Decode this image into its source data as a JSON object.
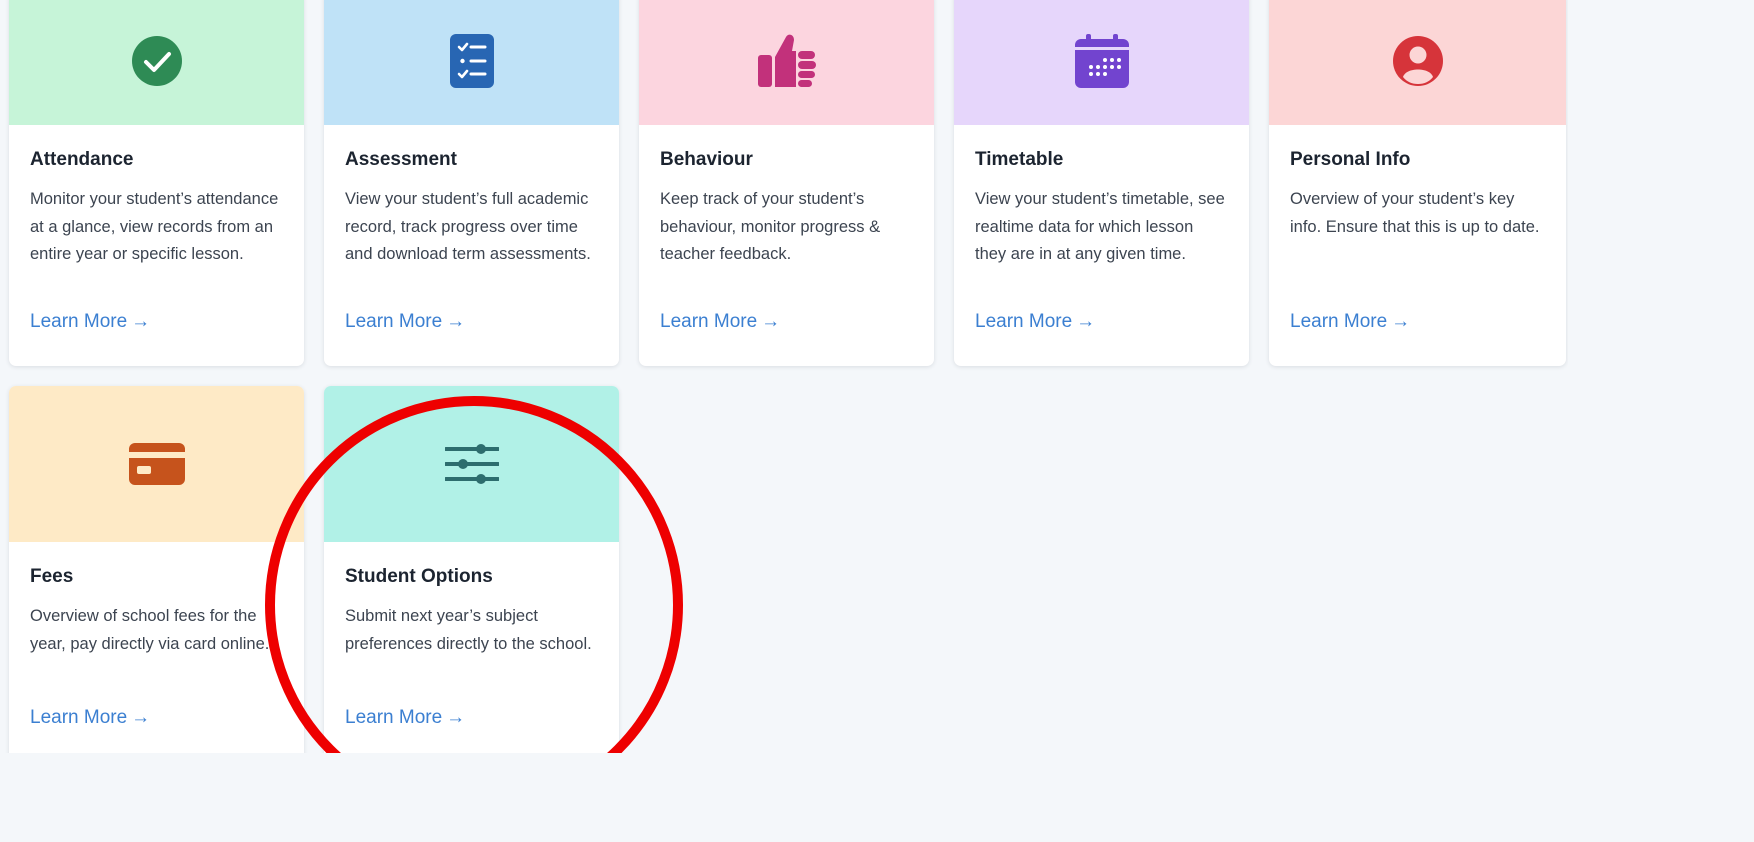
{
  "cards": [
    {
      "title": "Attendance",
      "description": "Monitor your student’s attendance at a glance, view records from an entire year or specific lesson.",
      "link": "Learn More",
      "icon": "check-circle-icon",
      "banner_color": "#c6f4d8",
      "icon_color": "#2e8b55"
    },
    {
      "title": "Assessment",
      "description": "View your student’s full academic record, track progress over time and download term assessments.",
      "link": "Learn More",
      "icon": "checklist-icon",
      "banner_color": "#bfe2f7",
      "icon_color": "#2866b3"
    },
    {
      "title": "Behaviour",
      "description": "Keep track of your student’s behaviour, monitor progress & teacher feedback.",
      "link": "Learn More",
      "icon": "thumbs-up-icon",
      "banner_color": "#fcd5df",
      "icon_color": "#c2317b"
    },
    {
      "title": "Timetable",
      "description": "View your student’s timetable, see realtime data for which lesson they are in at any given time.",
      "link": "Learn More",
      "icon": "calendar-icon",
      "banner_color": "#e6d6fb",
      "icon_color": "#7244cf"
    },
    {
      "title": "Personal Info",
      "description": "Overview of your student’s key info. Ensure that this is up to date.",
      "link": "Learn More",
      "icon": "user-circle-icon",
      "banner_color": "#fcd6d6",
      "icon_color": "#d6343a"
    },
    {
      "title": "Fees",
      "description": "Overview of school fees for the year, pay directly via card online.",
      "link": "Learn More",
      "icon": "credit-card-icon",
      "banner_color": "#feeac6",
      "icon_color": "#c6531c"
    },
    {
      "title": "Student Options",
      "description": "Submit next year’s subject preferences directly to the school.",
      "link": "Learn More",
      "icon": "sliders-icon",
      "banner_color": "#b1f1e7",
      "icon_color": "#2d6d6e"
    }
  ],
  "link_arrow": "→",
  "annotation_color": "#ee0000"
}
